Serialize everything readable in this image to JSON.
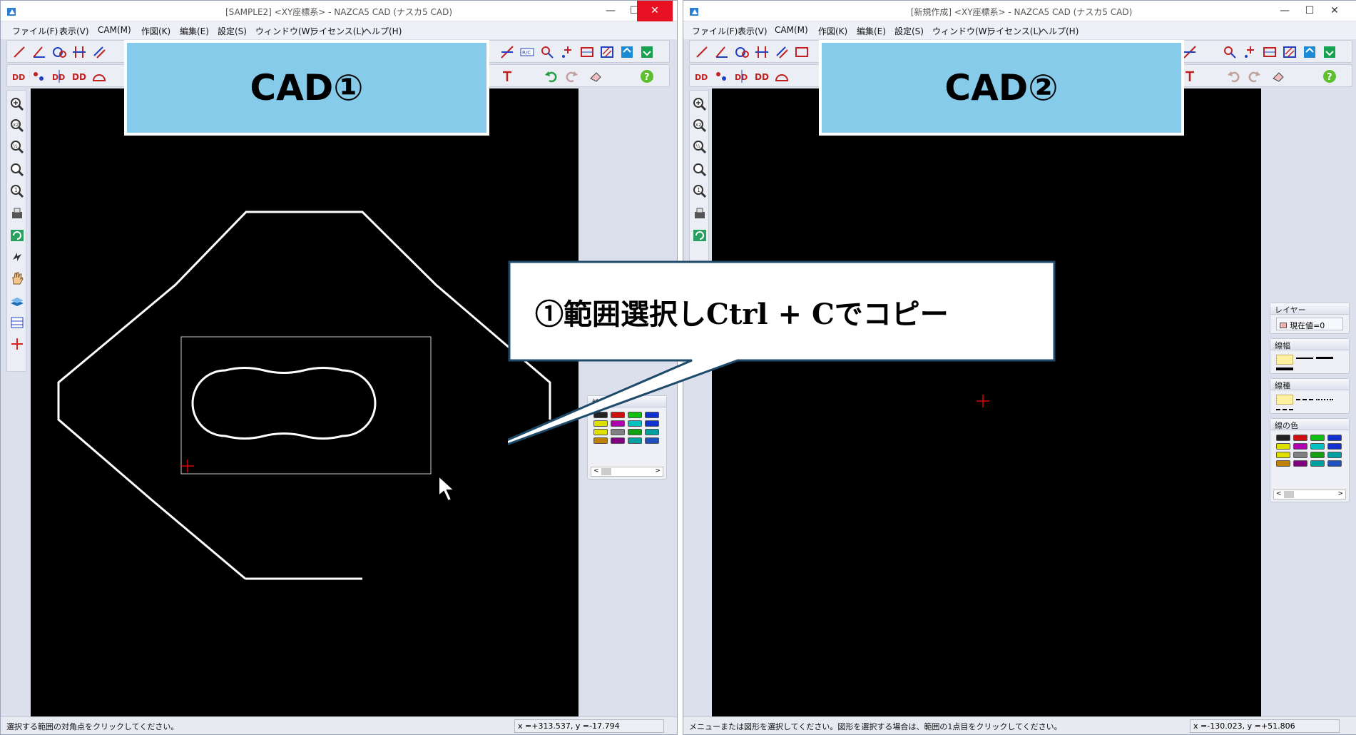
{
  "left_window": {
    "title": "[SAMPLE2] <XY座標系> - NAZCA5 CAD (ナスカ5 CAD)",
    "status_message": "選択する範囲の対角点をクリックしてください。",
    "coords": "x =+313.537,   y =-17.794",
    "overlay_label": "CAD①"
  },
  "right_window": {
    "title": "[新規作成] <XY座標系> - NAZCA5 CAD (ナスカ5 CAD)",
    "status_message": "メニューまたは図形を選択してください。図形を選択する場合は、範囲の1点目をクリックしてください。",
    "coords": "x =-130.023,   y =+51.806",
    "overlay_label": "CAD②"
  },
  "menu": [
    "ファイル(F)",
    "表示(V)",
    "CAM(M)",
    "作図(K)",
    "編集(E)",
    "設定(S)",
    "ウィンドウ(W)",
    "ライセンス(L)",
    "ヘルプ(H)"
  ],
  "window_controls": {
    "minimize": "—",
    "maximize": "☐",
    "close": "✕"
  },
  "side_panel": {
    "layer_title": "レイヤー",
    "layer_value": "現在値=0",
    "line_width_title": "線幅",
    "line_type_title": "線種",
    "line_color_title": "線の色",
    "scroll_left": "<",
    "scroll_right": ">"
  },
  "callout_text": "①範囲選択しCtrl + Cでコピー",
  "colors": {
    "accent_label_bg": "#87cbeb",
    "close_button": "#e81123",
    "canvas": "#000000",
    "crosshair": "#e00000"
  },
  "swatch_colors": [
    "#222222",
    "#d01010",
    "#10c010",
    "#1030d0",
    "#e0e000",
    "#b000b0",
    "#00c0c0",
    "#1030d0",
    "#e0e000",
    "#808080",
    "#10a010",
    "#00a0a0",
    "#c08000",
    "#800080",
    "#00a0a0",
    "#2050c0"
  ]
}
